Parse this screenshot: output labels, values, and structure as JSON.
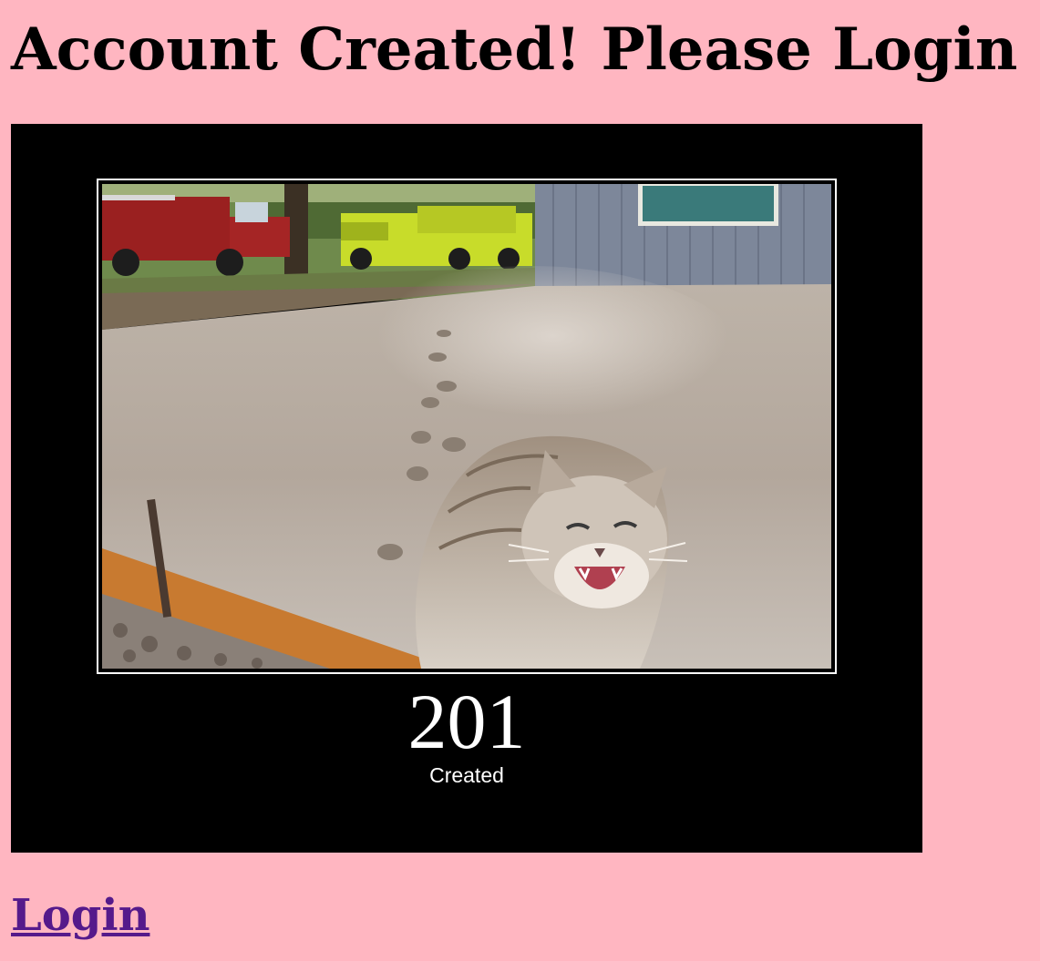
{
  "page": {
    "title": "Account Created! Please Login",
    "background_color": "#ffb6c1"
  },
  "poster": {
    "image_description": "Cat sitting on fresh concrete slab with paw prints leading toward it, trucks in background",
    "code": "201",
    "caption": "Created"
  },
  "login_link": {
    "label": "Login",
    "color": "#551a8b"
  }
}
